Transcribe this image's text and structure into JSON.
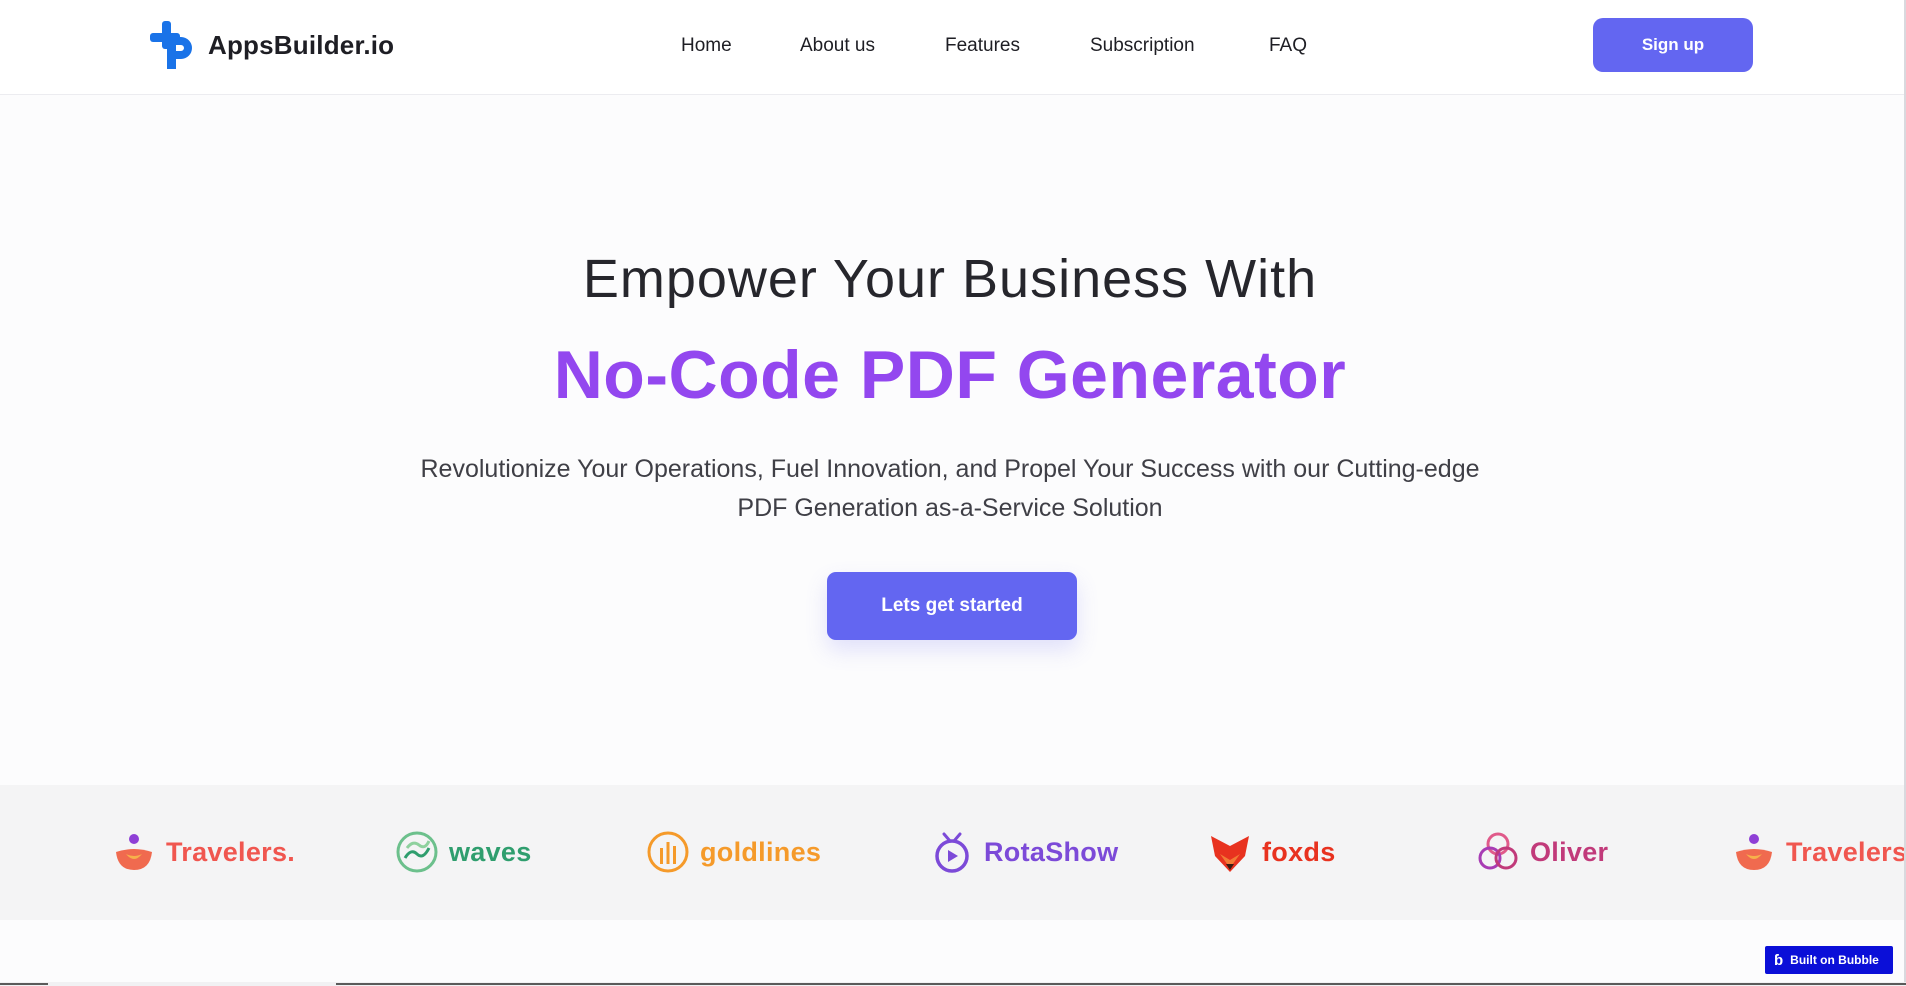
{
  "header": {
    "brand": "AppsBuilder.io",
    "nav": [
      {
        "label": "Home"
      },
      {
        "label": "About us"
      },
      {
        "label": "Features"
      },
      {
        "label": "Subscription"
      },
      {
        "label": "FAQ"
      }
    ],
    "signup_label": "Sign up"
  },
  "hero": {
    "title": "Empower Your Business With",
    "accent": "No-Code PDF Generator",
    "subtitle_line1": "Revolutionize Your Operations, Fuel Innovation, and Propel Your Success with our Cutting-edge",
    "subtitle_line2": "PDF Generation as-a-Service Solution",
    "cta_label": "Lets get started"
  },
  "partners": [
    {
      "name": "Travelers.",
      "icon": "lotus-icon",
      "color": "#f0564f"
    },
    {
      "name": "waves",
      "icon": "waves-icon",
      "color": "#2f9e6e"
    },
    {
      "name": "goldlines",
      "icon": "goldlines-icon",
      "color": "#f59a2a"
    },
    {
      "name": "RotaShow",
      "icon": "tv-icon",
      "color": "#7c4ad8"
    },
    {
      "name": "foxds",
      "icon": "fox-icon",
      "color": "#e8321f"
    },
    {
      "name": "Oliver",
      "icon": "rings-icon",
      "color": "#c13a7a"
    },
    {
      "name": "Travelers.",
      "icon": "lotus-icon",
      "color": "#f0564f"
    }
  ],
  "badge": {
    "label": "Built on Bubble"
  },
  "colors": {
    "primary": "#6366f1",
    "accent_text": "#9347ef",
    "badge": "#0b0fd8"
  }
}
